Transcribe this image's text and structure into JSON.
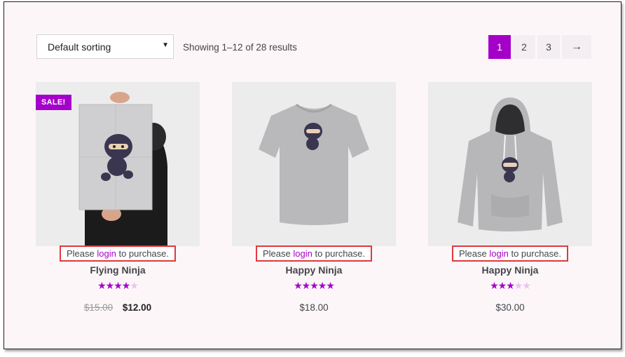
{
  "toolbar": {
    "sort_value": "Default sorting",
    "result_count": "Showing 1–12 of 28 results"
  },
  "pagination": {
    "pages": [
      "1",
      "2",
      "3"
    ],
    "current": "1",
    "next_label": "→"
  },
  "products": [
    {
      "title": "Flying Ninja",
      "badge": "SALE!",
      "rating": 4,
      "rating_max": 5,
      "old_price": "$15.00",
      "price": "$12.00",
      "notice_before": "Please",
      "notice_link": "login",
      "notice_after": "to purchase."
    },
    {
      "title": "Happy Ninja",
      "rating": 5,
      "rating_max": 5,
      "price": "$18.00",
      "notice_before": "Please",
      "notice_link": "login",
      "notice_after": "to purchase."
    },
    {
      "title": "Happy Ninja",
      "rating": 3,
      "rating_max": 5,
      "price": "$30.00",
      "notice_before": "Please",
      "notice_link": "login",
      "notice_after": "to purchase."
    }
  ],
  "colors": {
    "accent": "#a500c9",
    "notice_border": "#e0393e"
  }
}
